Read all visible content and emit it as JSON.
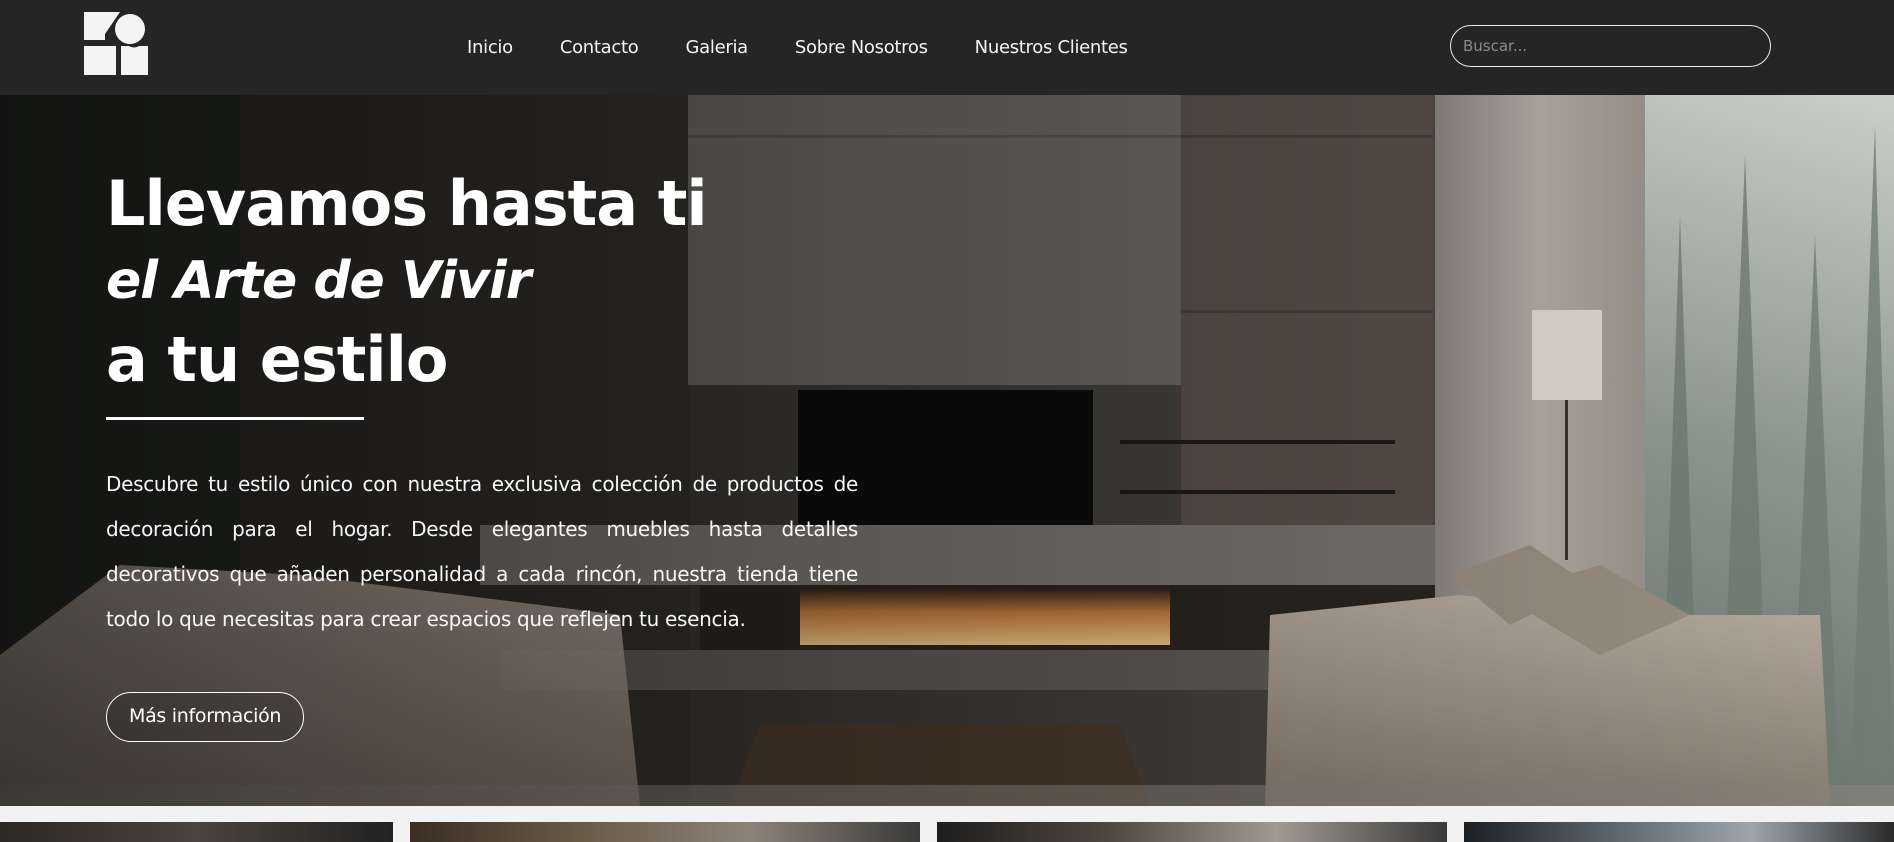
{
  "header": {
    "logo_icon": "geometric-shapes-logo",
    "nav": [
      {
        "label": "Inicio"
      },
      {
        "label": "Contacto"
      },
      {
        "label": "Galeria"
      },
      {
        "label": "Sobre Nosotros"
      },
      {
        "label": "Nuestros Clientes"
      }
    ],
    "search": {
      "placeholder": "Buscar...",
      "value": ""
    }
  },
  "hero": {
    "title_line1": "Llevamos hasta ti",
    "title_line2": "el Arte de Vivir",
    "title_line3": "a tu estilo",
    "description": "Descubre tu estilo único con nuestra exclusiva colección de productos de decoración para el hogar. Desde elegantes muebles hasta detalles decorativos que añaden personalidad a cada rincón, nuestra tienda tiene todo lo que necesitas para crear espacios que reflejen tu esencia.",
    "cta_label": "Más información",
    "background_image": "modern-living-room-fireplace-photo"
  },
  "colors": {
    "header_bg": "#252525",
    "text": "#ffffff",
    "page_bg": "#f2f2f2"
  }
}
